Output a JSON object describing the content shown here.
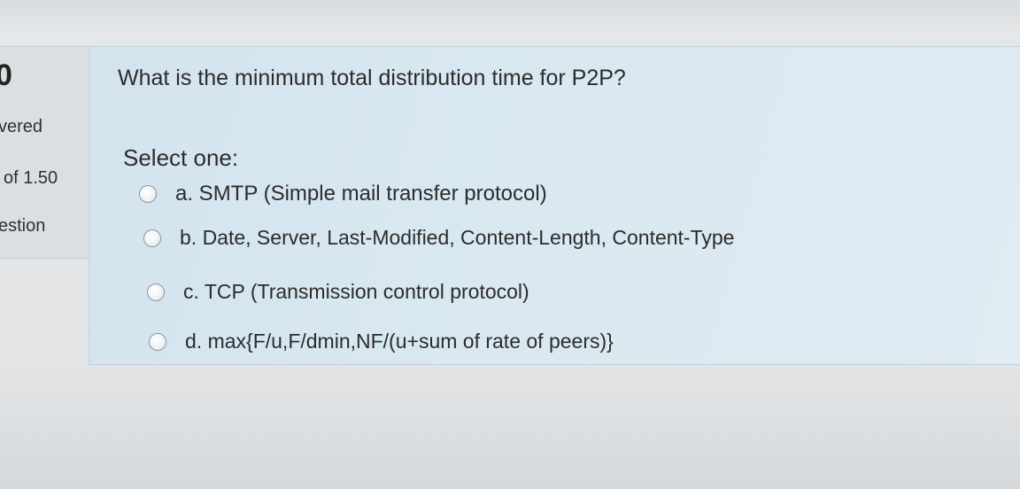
{
  "question_info": {
    "number": "0",
    "status": "vered",
    "mark": "of 1.50",
    "flag": "estion"
  },
  "question": {
    "text": "What is the minimum total distribution time for P2P?",
    "prompt": "Select one:",
    "options": [
      {
        "label": "a. SMTP (Simple mail transfer protocol)"
      },
      {
        "label": "b. Date, Server, Last-Modified, Content-Length, Content-Type"
      },
      {
        "label": "c. TCP (Transmission control protocol)"
      },
      {
        "label": "d. max{F/u,F/dmin,NF/(u+sum of rate of peers)}"
      }
    ]
  }
}
